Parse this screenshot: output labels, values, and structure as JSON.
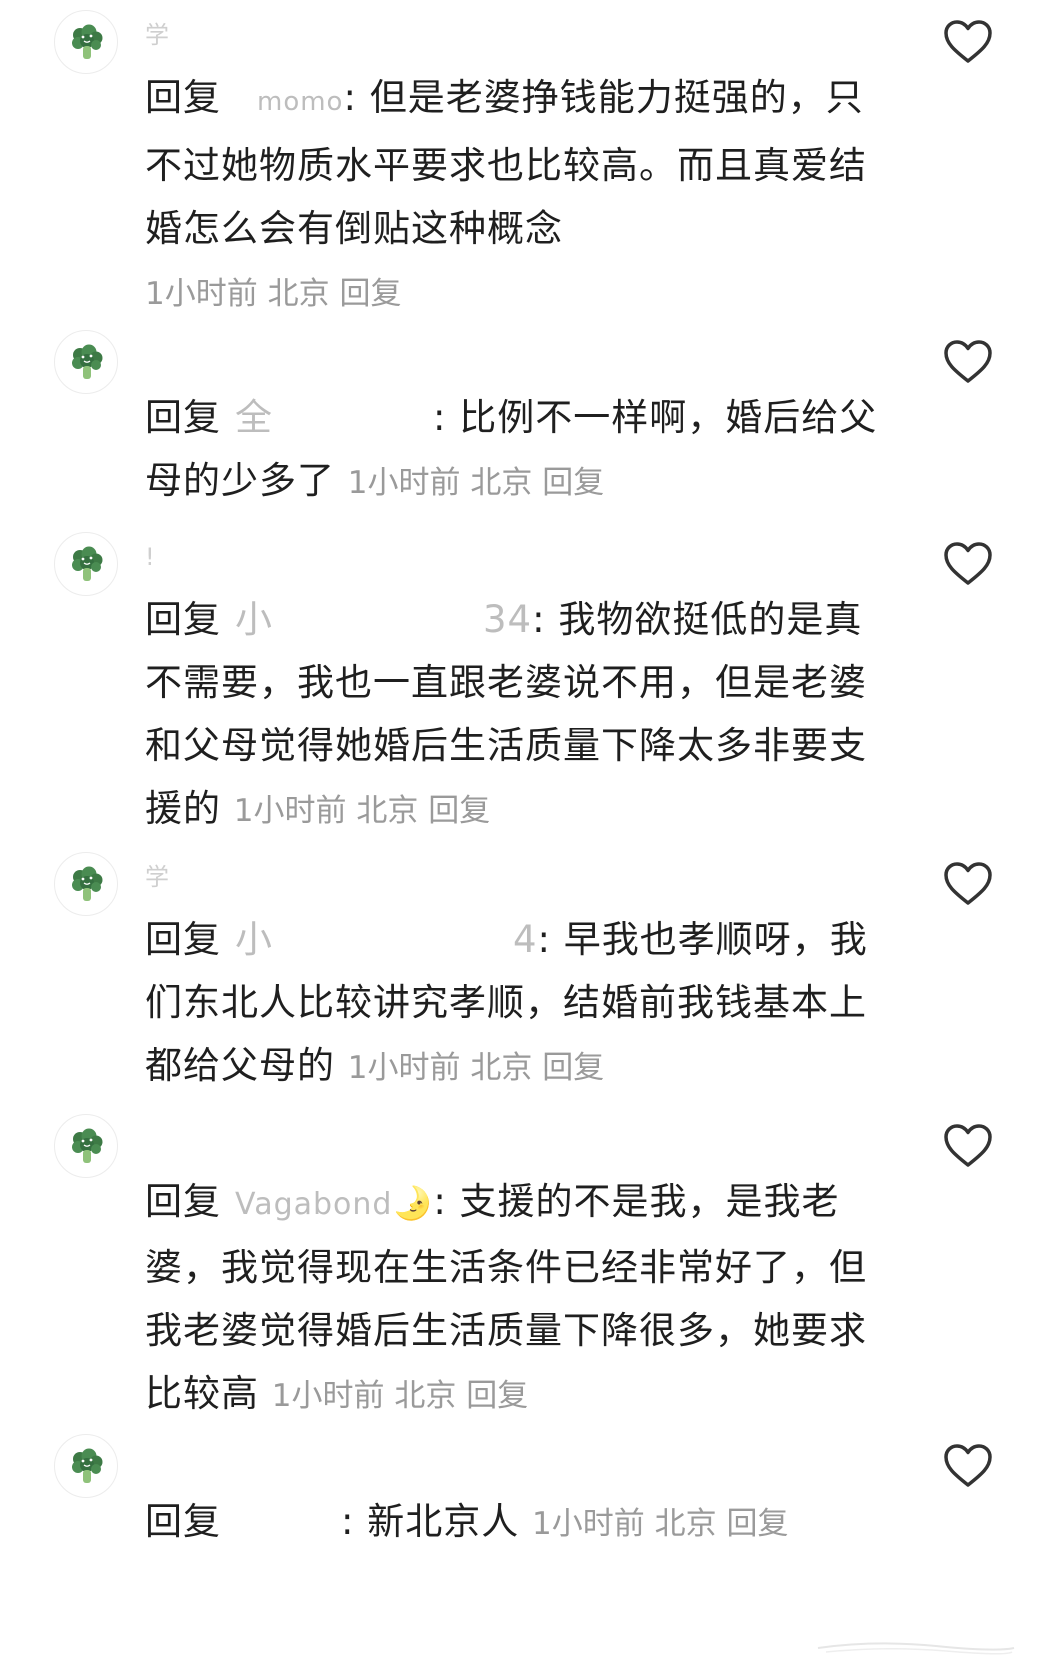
{
  "comments": [
    {
      "nickname": "学",
      "reply_prefix": "回复",
      "reply_target": "momo",
      "text": ": 但是老婆挣钱能力挺强的，只不过她物质水平要求也比较高。而且真爱结婚怎么会有倒贴这种概念",
      "time": "1小时前",
      "location": "北京",
      "reply_label": "回复"
    },
    {
      "nickname": "",
      "reply_prefix": "回复",
      "reply_target": "全",
      "text": ": 比例不一样啊，婚后给父母的少多了",
      "time": "1小时前",
      "location": "北京",
      "reply_label": "回复"
    },
    {
      "nickname": "!",
      "reply_prefix": "回复",
      "reply_target": "小",
      "reply_target_tail": "34",
      "text": ": 我物欲挺低的是真不需要，我也一直跟老婆说不用，但是老婆和父母觉得她婚后生活质量下降太多非要支援的",
      "time": "1小时前",
      "location": "北京",
      "reply_label": "回复"
    },
    {
      "nickname": "学",
      "reply_prefix": "回复",
      "reply_target": "小",
      "reply_target_tail": "4",
      "text": ": 早我也孝顺呀，我们东北人比较讲究孝顺，结婚前我钱基本上都给父母的",
      "time": "1小时前",
      "location": "北京",
      "reply_label": "回复"
    },
    {
      "nickname": "",
      "reply_prefix": "回复",
      "reply_target": "Vagabond",
      "reply_target_emoji": "🌛",
      "text": ": 支援的不是我，是我老婆，我觉得现在生活条件已经非常好了，但我老婆觉得婚后生活质量下降很多，她要求比较高",
      "time": "1小时前",
      "location": "北京",
      "reply_label": "回复"
    },
    {
      "nickname": "",
      "reply_prefix": "回复",
      "reply_target": "",
      "text": ": 新北京人",
      "time": "1小时前",
      "location": "北京",
      "reply_label": "回复"
    }
  ],
  "icons": {
    "avatar": "broccoli-icon",
    "like": "heart-outline-icon"
  },
  "colors": {
    "text": "#1f1f1f",
    "meta": "#9a9a9a",
    "masked_name": "#bdbdbd",
    "avatar_green": "#3d7a45",
    "heart_stroke": "#333333"
  }
}
